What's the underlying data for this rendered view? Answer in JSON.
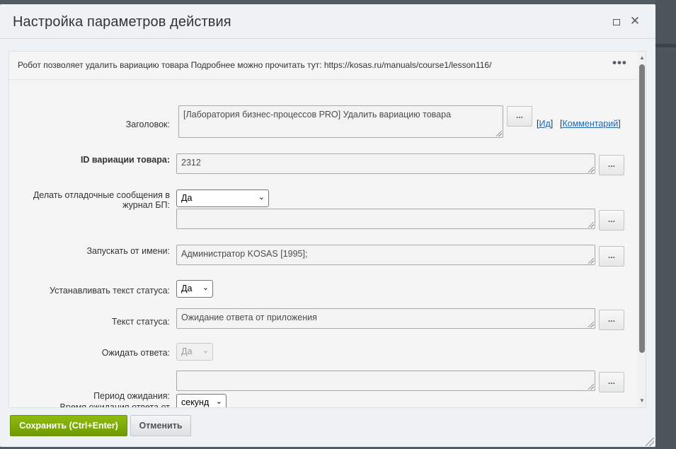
{
  "dialog": {
    "title": "Настройка параметров действия",
    "description": "Робот позволяет удалить вариацию товара Подробнее можно прочитать тут: https://kosas.ru/manuals/course1/lesson116/"
  },
  "form": {
    "title_label": "Заголовок:",
    "title_value": "[Лаборатория бизнес-процессов PRO] Удалить вариацию товара",
    "id_link_label": "Ид",
    "comment_link_label": "Комментарий",
    "variation_id_label": "ID вариации товара:",
    "variation_id_value": "2312",
    "debug_label_line1": "Делать отладочные сообщения в",
    "debug_label_line2": "журнал БП:",
    "debug_select_value": "Да",
    "debug_value": "",
    "run_as_label": "Запускать от имени:",
    "run_as_value": "Администратор KOSAS [1995];",
    "set_status_label": "Устанавливать текст статуса:",
    "set_status_select_value": "Да",
    "status_text_label": "Текст статуса:",
    "status_text_value": "Ожидание ответа от приложения",
    "wait_answer_label": "Ожидать ответа:",
    "wait_answer_select_value": "Да",
    "wait_period_label": "Период ожидания:",
    "wait_period_value": "",
    "wait_time_label_partial": "Время ожидания ответа от",
    "wait_unit_select_value": "секунд",
    "dots_label": "..."
  },
  "footer": {
    "save_label": "Сохранить (Ctrl+Enter)",
    "cancel_label": "Отменить"
  },
  "colors": {
    "save_button": "#7cab07",
    "link": "#2067b0",
    "dialog_bg": "#eef2f4"
  }
}
